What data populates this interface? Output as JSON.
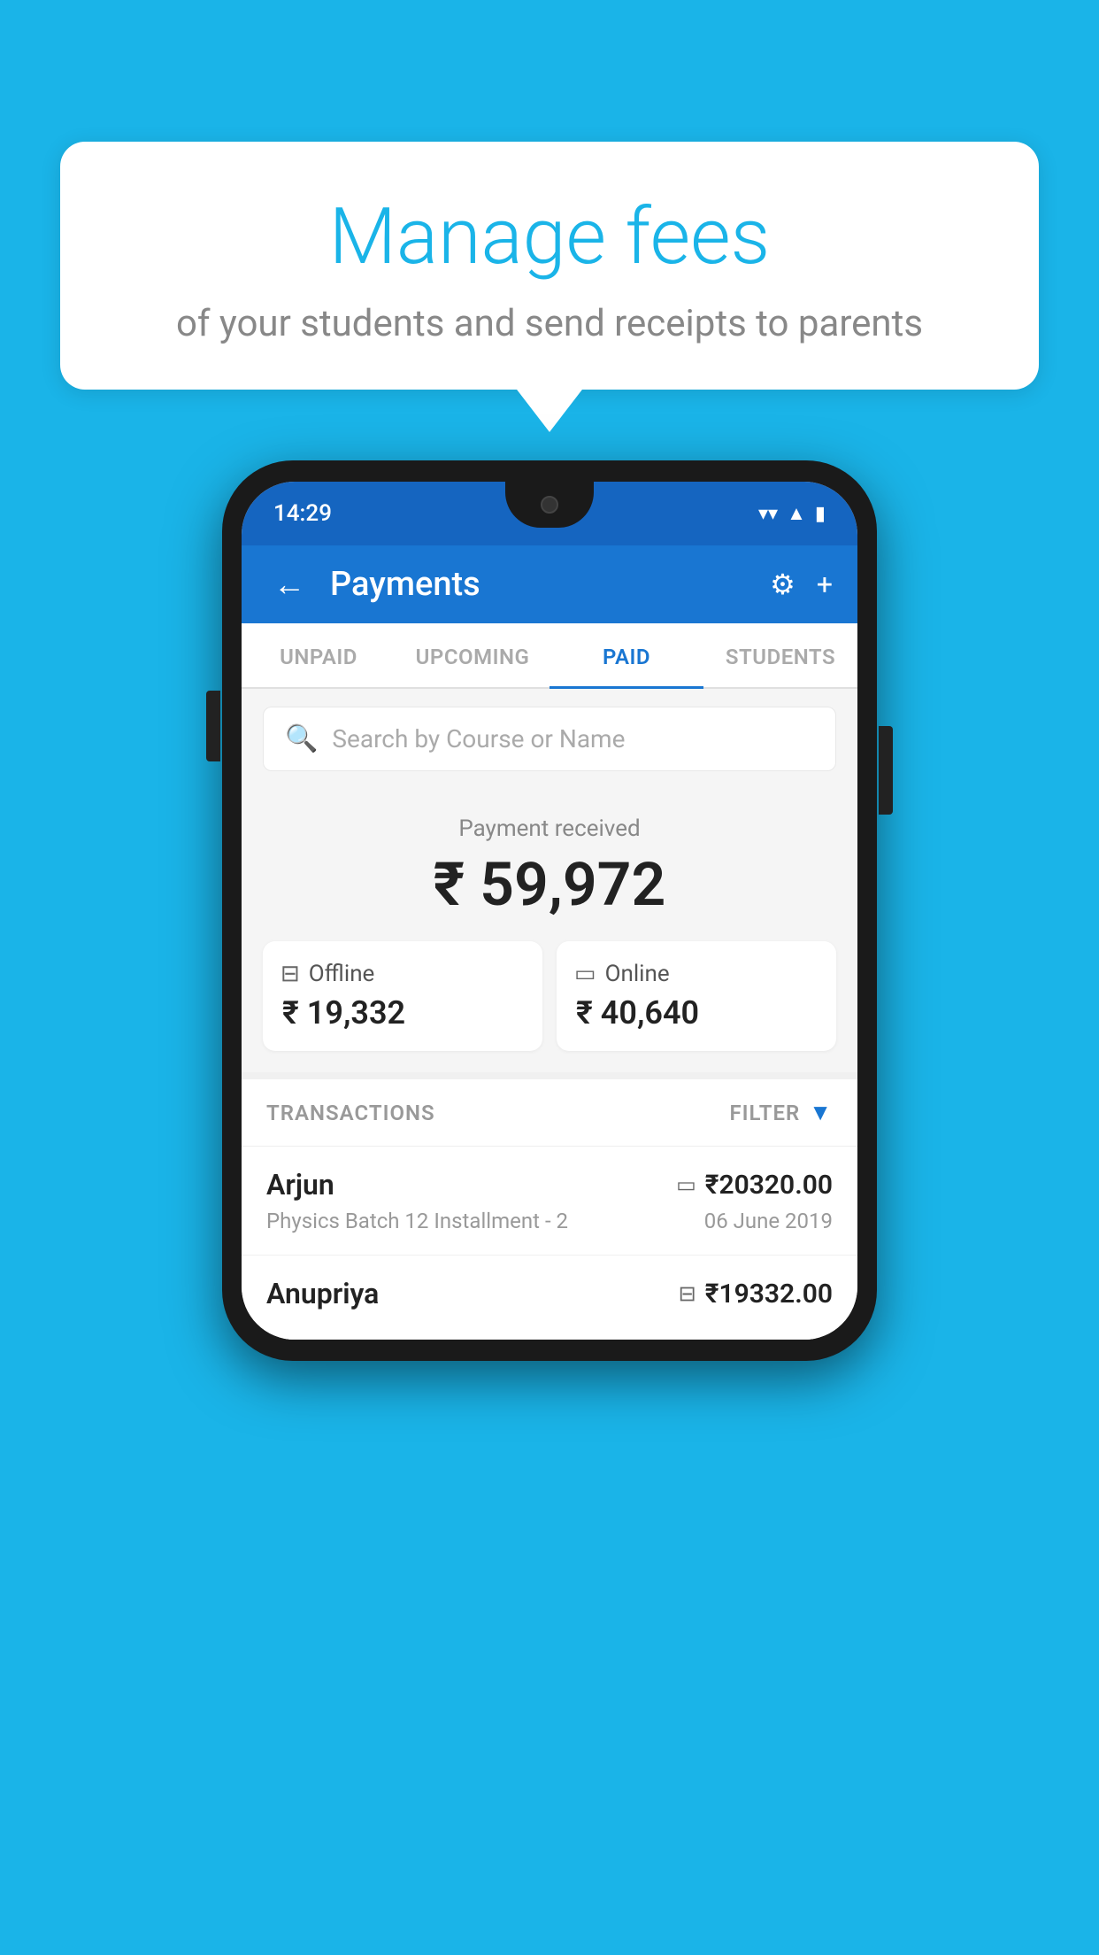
{
  "background": "#1ab4e8",
  "bubble": {
    "title": "Manage fees",
    "subtitle": "of your students and send receipts to parents"
  },
  "status_bar": {
    "time": "14:29",
    "icons": [
      "wifi",
      "signal",
      "battery"
    ]
  },
  "header": {
    "title": "Payments",
    "back_label": "←",
    "settings_label": "⚙",
    "add_label": "+"
  },
  "tabs": [
    {
      "label": "UNPAID",
      "active": false
    },
    {
      "label": "UPCOMING",
      "active": false
    },
    {
      "label": "PAID",
      "active": true
    },
    {
      "label": "STUDENTS",
      "active": false
    }
  ],
  "search": {
    "placeholder": "Search by Course or Name"
  },
  "payment_summary": {
    "received_label": "Payment received",
    "total_amount": "₹ 59,972",
    "offline": {
      "label": "Offline",
      "amount": "₹ 19,332"
    },
    "online": {
      "label": "Online",
      "amount": "₹ 40,640"
    }
  },
  "transactions": {
    "section_label": "TRANSACTIONS",
    "filter_label": "FILTER",
    "rows": [
      {
        "name": "Arjun",
        "description": "Physics Batch 12 Installment - 2",
        "amount": "₹20320.00",
        "date": "06 June 2019",
        "type": "online"
      },
      {
        "name": "Anupriya",
        "description": "",
        "amount": "₹19332.00",
        "date": "",
        "type": "offline"
      }
    ]
  }
}
